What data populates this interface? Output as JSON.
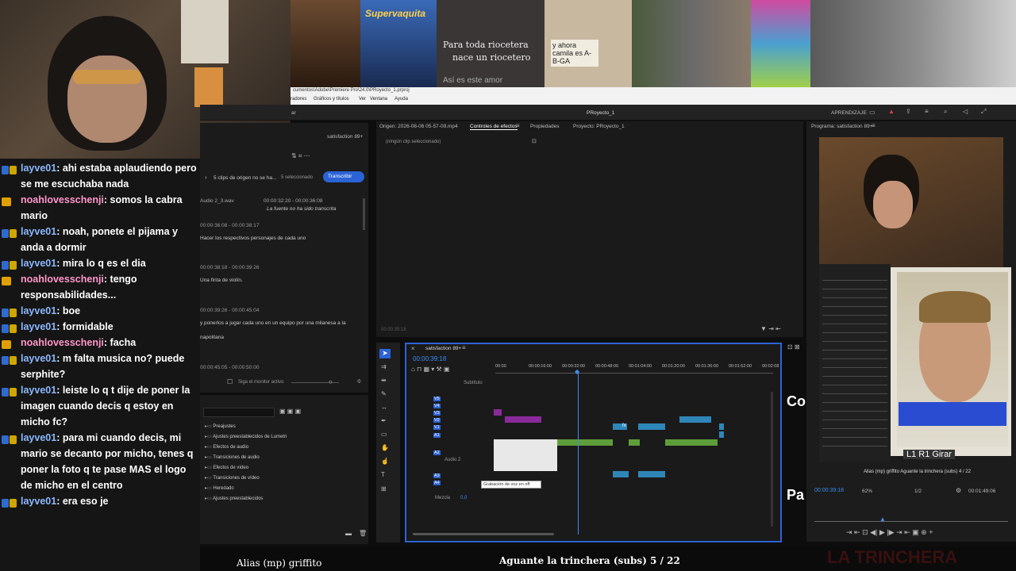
{
  "strip": {
    "supervaquita": "Supervaquita",
    "riocetera_1": "Para toda riocetera",
    "riocetera_2": "nace un riocetero",
    "note": "y ahora camila es A-B-GA",
    "caption": "Así es este amor"
  },
  "menubar": {
    "path": "cumentos\\Adobe\\Premiere Pro\\24.0\\PRoyecto_1.prproj",
    "items": [
      "radores",
      "Gráficos y títulos",
      "Ver",
      "Ventana",
      "Ayuda"
    ]
  },
  "window": {
    "project_title": "PRoyecto_1",
    "workspace": "APRENDIZAJE",
    "left_tab": "ar",
    "left_seq": "satisfaction 89+"
  },
  "chat": [
    {
      "badge": "mod",
      "user": "layve01",
      "text": ": ahi estaba aplaudiendo pero se me escuchaba nada"
    },
    {
      "badge": "vip",
      "user": "noahlovesschenji",
      "text": ": somos la cabra mario"
    },
    {
      "badge": "mod",
      "user": "layve01",
      "text": ": noah, ponete el pijama y anda a dormir"
    },
    {
      "badge": "mod",
      "user": "layve01",
      "text": ": mira lo q es el dia"
    },
    {
      "badge": "vip",
      "user": "noahlovesschenji",
      "text": ": tengo responsabilidades..."
    },
    {
      "badge": "mod",
      "user": "layve01",
      "text": ": boe"
    },
    {
      "badge": "mod",
      "user": "layve01",
      "text": ": formidable"
    },
    {
      "badge": "vip",
      "user": "noahlovesschenji",
      "text": ": facha"
    },
    {
      "badge": "mod",
      "user": "layve01",
      "text": ": m falta musica no? puede serphite?"
    },
    {
      "badge": "mod",
      "user": "layve01",
      "text": ": leiste lo q t dije de poner la imagen cuando decis q estoy en micho fc?"
    },
    {
      "badge": "mod",
      "user": "layve01",
      "text": ": para mi cuando decis, mi mario se decanto por micho, tenes q poner la foto q te pase MAS el logo de micho en el centro"
    },
    {
      "badge": "mod",
      "user": "layve01",
      "text": ": era eso je"
    }
  ],
  "transcript": {
    "clips_notice": "5 clips de origen no se ha...",
    "selected": "5 seleccionado",
    "button": "Transcribir",
    "rows": [
      {
        "name": "Audio 2_3.wav",
        "time": "00:00:32:20 - 00:00:36:08",
        "text": "La fuente no ha sido transcrita"
      },
      {
        "name": "00:00:36:08 - 00:00:38:17",
        "time": "",
        "text": "Hacer los respectivos personajes de cada uno"
      },
      {
        "name": "00:00:38:18 - 00:00:39:26",
        "time": "",
        "text": "Una finta de violín."
      },
      {
        "name": "00:00:39:26 - 00:00:45:04",
        "time": "",
        "text": "y ponerlos a jugar cada uno en un equipo por una milanesa a la"
      },
      {
        "name": "",
        "time": "",
        "text": "napolitana"
      },
      {
        "name": "00:00:45:05 - 00:00:50:00",
        "time": "",
        "text": ""
      }
    ],
    "follow_monitor": "Siga el monitor activo"
  },
  "effects": {
    "items": [
      "Preajustes",
      "Ajustes preestablecidos de Lumetri",
      "Efectos de audio",
      "Transiciones de audio",
      "Efectos de vídeo",
      "Transiciones de vídeo",
      "Heredado",
      "Ajustes preestablecidos"
    ]
  },
  "controls": {
    "origin_tab": "Origen: 2026-08-06 05-57-09.mp4",
    "effect_controls_tab": "Controles de efectos",
    "properties_tab": "Propiedades",
    "project_tab": "Proyecto: PRoyecto_1",
    "no_clip": "(ningún clip seleccionado)",
    "timecode": "00:00:39:18"
  },
  "timeline": {
    "seq_name": "satisfaction 89+",
    "timecode": "00:00:39:18",
    "ruler": [
      "00:00",
      "00:00:16:00",
      "00:00:32:00",
      "00:00:48:00",
      "00:01:04:00",
      "00:01:20:00",
      "00:01:36:00",
      "00:01:52:00",
      "00:02:08"
    ],
    "subtitle_track": "Subtítulo",
    "tracks_v": [
      "V5",
      "V4",
      "V3",
      "V2",
      "V1"
    ],
    "tracks_a": [
      "A1",
      "A2",
      "A3",
      "A4"
    ],
    "audio_label": "Audio 2",
    "mix_label": "Mezcla",
    "mix_val": "0,0",
    "tooltip": "Grabación de voz en off",
    "fx_mark": "fx"
  },
  "program": {
    "title": "Programa: satisfaction 89+",
    "timecode": "00:00:39:18",
    "zoom": "62%",
    "res": "1/2",
    "duration": "00:01:49:06",
    "bar_label": "Alias (mp) griffito  Aguante la trinchera (subs) 4 / 22",
    "game_hint": "L1  R1  Girar"
  },
  "side_text": {
    "co": "Co",
    "pa": "Pa"
  },
  "bottom": {
    "left": "Alias (mp) griffito",
    "center": "Aguante la trinchera (subs) 5 / 22",
    "right": "LA TRINCHERA"
  },
  "colors": {
    "accent": "#2b63d7",
    "clip_green": "#5e9e3a",
    "clip_blue": "#2f86b8",
    "clip_purple": "#8a2a9a",
    "playhead": "#3b8df0"
  }
}
